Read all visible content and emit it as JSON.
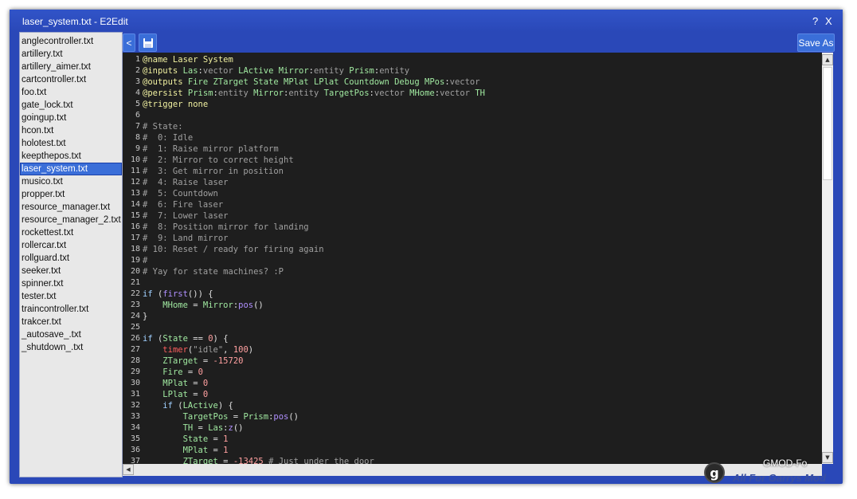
{
  "window": {
    "title": "laser_system.txt - E2Edit",
    "help_label": "?",
    "close_label": "X"
  },
  "toolbar": {
    "back_label": "<",
    "save_icon": "floppy-disk-icon",
    "save_as_label": "Save As"
  },
  "files": [
    "anglecontroller.txt",
    "artillery.txt",
    "artillery_aimer.txt",
    "cartcontroller.txt",
    "foo.txt",
    "gate_lock.txt",
    "goingup.txt",
    "hcon.txt",
    "holotest.txt",
    "keepthepos.txt",
    "laser_system.txt",
    "musico.txt",
    "propper.txt",
    "resource_manager.txt",
    "resource_manager_2.txt",
    "rockettest.txt",
    "rollercar.txt",
    "rollguard.txt",
    "seeker.txt",
    "spinner.txt",
    "tester.txt",
    "traincontroller.txt",
    "trakcer.txt",
    "_autosave_.txt",
    "_shutdown_.txt"
  ],
  "selected_file": "laser_system.txt",
  "code_lines": [
    [
      [
        "dir",
        "@name Laser System"
      ]
    ],
    [
      [
        "dir",
        "@inputs "
      ],
      [
        "var",
        "Las"
      ],
      [
        "txt",
        ":"
      ],
      [
        "typ",
        "vector"
      ],
      [
        "txt",
        " "
      ],
      [
        "var",
        "LActive"
      ],
      [
        "txt",
        " "
      ],
      [
        "var",
        "Mirror"
      ],
      [
        "txt",
        ":"
      ],
      [
        "typ",
        "entity"
      ],
      [
        "txt",
        " "
      ],
      [
        "var",
        "Prism"
      ],
      [
        "txt",
        ":"
      ],
      [
        "typ",
        "entity"
      ]
    ],
    [
      [
        "dir",
        "@outputs "
      ],
      [
        "var",
        "Fire ZTarget State MPlat LPlat Countdown Debug MPos"
      ],
      [
        "txt",
        ":"
      ],
      [
        "typ",
        "vector"
      ]
    ],
    [
      [
        "dir",
        "@persist "
      ],
      [
        "var",
        "Prism"
      ],
      [
        "txt",
        ":"
      ],
      [
        "typ",
        "entity"
      ],
      [
        "txt",
        " "
      ],
      [
        "var",
        "Mirror"
      ],
      [
        "txt",
        ":"
      ],
      [
        "typ",
        "entity"
      ],
      [
        "txt",
        " "
      ],
      [
        "var",
        "TargetPos"
      ],
      [
        "txt",
        ":"
      ],
      [
        "typ",
        "vector"
      ],
      [
        "txt",
        " "
      ],
      [
        "var",
        "MHome"
      ],
      [
        "txt",
        ":"
      ],
      [
        "typ",
        "vector"
      ],
      [
        "txt",
        " "
      ],
      [
        "var",
        "TH"
      ]
    ],
    [
      [
        "dir",
        "@trigger none"
      ]
    ],
    [],
    [
      [
        "cmt",
        "# State:"
      ]
    ],
    [
      [
        "cmt",
        "#  0: Idle"
      ]
    ],
    [
      [
        "cmt",
        "#  1: Raise mirror platform"
      ]
    ],
    [
      [
        "cmt",
        "#  2: Mirror to correct height"
      ]
    ],
    [
      [
        "cmt",
        "#  3: Get mirror in position"
      ]
    ],
    [
      [
        "cmt",
        "#  4: Raise laser"
      ]
    ],
    [
      [
        "cmt",
        "#  5: Countdown"
      ]
    ],
    [
      [
        "cmt",
        "#  6: Fire laser"
      ]
    ],
    [
      [
        "cmt",
        "#  7: Lower laser"
      ]
    ],
    [
      [
        "cmt",
        "#  8: Position mirror for landing"
      ]
    ],
    [
      [
        "cmt",
        "#  9: Land mirror"
      ]
    ],
    [
      [
        "cmt",
        "# 10: Reset / ready for firing again"
      ]
    ],
    [
      [
        "cmt",
        "#"
      ]
    ],
    [
      [
        "cmt",
        "# Yay for state machines? :P"
      ]
    ],
    [],
    [
      [
        "kw",
        "if"
      ],
      [
        "txt",
        " ("
      ],
      [
        "fn",
        "first"
      ],
      [
        "txt",
        "()) {"
      ]
    ],
    [
      [
        "txt",
        "    "
      ],
      [
        "var",
        "MHome"
      ],
      [
        "txt",
        " = "
      ],
      [
        "var",
        "Mirror"
      ],
      [
        "txt",
        ":"
      ],
      [
        "fn",
        "pos"
      ],
      [
        "txt",
        "()"
      ]
    ],
    [
      [
        "txt",
        "}"
      ]
    ],
    [],
    [
      [
        "kw",
        "if"
      ],
      [
        "txt",
        " ("
      ],
      [
        "var",
        "State"
      ],
      [
        "txt",
        " == "
      ],
      [
        "num",
        "0"
      ],
      [
        "txt",
        ") {"
      ]
    ],
    [
      [
        "txt",
        "    "
      ],
      [
        "tmr",
        "timer"
      ],
      [
        "txt",
        "("
      ],
      [
        "str",
        "\"idle\""
      ],
      [
        "txt",
        ", "
      ],
      [
        "num",
        "100"
      ],
      [
        "txt",
        ")"
      ]
    ],
    [
      [
        "txt",
        "    "
      ],
      [
        "var",
        "ZTarget"
      ],
      [
        "txt",
        " = "
      ],
      [
        "num",
        "-15720"
      ]
    ],
    [
      [
        "txt",
        "    "
      ],
      [
        "var",
        "Fire"
      ],
      [
        "txt",
        " = "
      ],
      [
        "num",
        "0"
      ]
    ],
    [
      [
        "txt",
        "    "
      ],
      [
        "var",
        "MPlat"
      ],
      [
        "txt",
        " = "
      ],
      [
        "num",
        "0"
      ]
    ],
    [
      [
        "txt",
        "    "
      ],
      [
        "var",
        "LPlat"
      ],
      [
        "txt",
        " = "
      ],
      [
        "num",
        "0"
      ]
    ],
    [
      [
        "txt",
        "    "
      ],
      [
        "kw",
        "if"
      ],
      [
        "txt",
        " ("
      ],
      [
        "var",
        "LActive"
      ],
      [
        "txt",
        ") {"
      ]
    ],
    [
      [
        "txt",
        "        "
      ],
      [
        "var",
        "TargetPos"
      ],
      [
        "txt",
        " = "
      ],
      [
        "var",
        "Prism"
      ],
      [
        "txt",
        ":"
      ],
      [
        "fn",
        "pos"
      ],
      [
        "txt",
        "()"
      ]
    ],
    [
      [
        "txt",
        "        "
      ],
      [
        "var",
        "TH"
      ],
      [
        "txt",
        " = "
      ],
      [
        "var",
        "Las"
      ],
      [
        "txt",
        ":"
      ],
      [
        "fn",
        "z"
      ],
      [
        "txt",
        "()"
      ]
    ],
    [
      [
        "txt",
        "        "
      ],
      [
        "var",
        "State"
      ],
      [
        "txt",
        " = "
      ],
      [
        "num",
        "1"
      ]
    ],
    [
      [
        "txt",
        "        "
      ],
      [
        "var",
        "MPlat"
      ],
      [
        "txt",
        " = "
      ],
      [
        "num",
        "1"
      ]
    ],
    [
      [
        "txt",
        "        "
      ],
      [
        "var",
        "ZTarget"
      ],
      [
        "txt",
        " = "
      ],
      [
        "num",
        "-13425"
      ],
      [
        "txt",
        " "
      ],
      [
        "cmt",
        "# Just under the door"
      ]
    ]
  ],
  "overlay": {
    "logo_letter": "g",
    "gmod_text": "GMOD-Fo",
    "aff_text": "All For Garrys Mod"
  }
}
